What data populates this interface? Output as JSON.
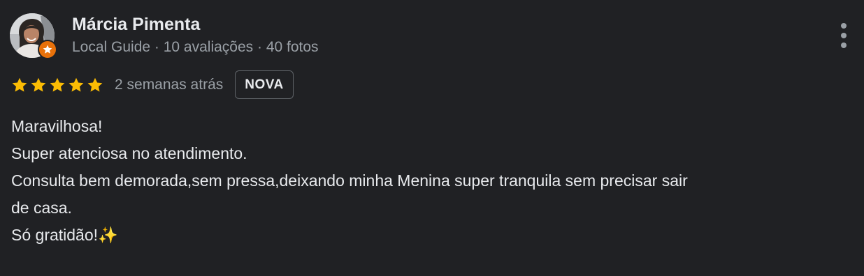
{
  "author": {
    "name": "Márcia Pimenta",
    "meta": "Local Guide · 10 avaliações · 40 fotos",
    "avatar_icon": "person-photo-avatar",
    "badge_icon": "local-guide-star-icon",
    "badge_color": "#e8710a"
  },
  "rating": {
    "stars": 5,
    "max_stars": 5,
    "star_color": "#fbbc04",
    "date": "2 semanas atrás",
    "new_label": "NOVA"
  },
  "menu": {
    "icon": "more-vert-icon"
  },
  "review": {
    "lines": [
      "Maravilhosa!",
      "Super atenciosa no atendimento.",
      "Consulta bem demorada,sem pressa,deixando minha Menina super tranquila sem precisar sair",
      "de casa.",
      "Só gratidão!✨"
    ]
  },
  "colors": {
    "background": "#202124",
    "primary_text": "#e8eaed",
    "secondary_text": "#9aa0a6",
    "border": "#5f6368"
  }
}
